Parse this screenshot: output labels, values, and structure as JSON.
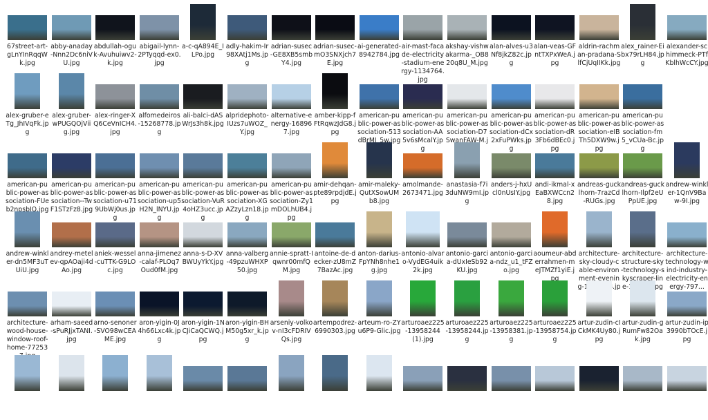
{
  "files": [
    [
      "67street-art-gLnYInRqqWk.jpg",
      "abby-anaday-Nnn2Dc6niVU.jpg",
      "abdullah-oguk-Avuhuiwv2-k.jpg",
      "abigail-lynn-2PTyqqd-ex0.jpg",
      "a-c-qA894E_ILPo.jpg",
      "adly-hakim-Ir98XAtj1Ms.jpg",
      "adrian-susec-GE8XB5smbY4.jpg",
      "adrian-susec-mO3SNXjch7E.jpg",
      "ai-generated-8942784.jpg",
      "air-mast-facade-electricity-stadium-energy-1134764.jpg",
      "akshay-vishwakarma-_OB820q8U_M.jpg",
      "alan-alves-u3Nf8jkZ82c.jpg",
      "alan-veas-GFntTXPxWeA.jpg",
      "aldrin-rachman-pradana-SlfCjUqIIKk.jpg",
      "alex_rainer-Eibx79rLH84.jpg",
      "alexander-schimmeck-PTfKblhWcCY.jpg"
    ],
    [
      "alex-gruber-eTg_JhIVqFk.jpg",
      "alex-gruber-wPUGQOjViig.jpg",
      "alex-ringer-XQ6CeVnICH4.jpg",
      "alfomedeiros-15268778.jpg",
      "ali-balci-dASWrJs3h8k.jpg",
      "alpridephoto-IUzs7uWOZ_Y.jpg",
      "alternative-energy-168967.jpg",
      "amber-kipp-fFtRqwzJdG8.jpg",
      "american-public-power-association-513dBrMJ_5w.jpg",
      "american-public-power-association-AA5v6sMcalY.jpg",
      "american-public-power-association-D7SwanFAW-M.jpg",
      "american-public-power-association-dCx2xFuPWks.jpg",
      "american-public-power-association-dR3Fb6dBEc0.jpg",
      "american-public-power-association-eIBTh5DXW9w.jpg",
      "american-public-power-association-fm5_vCUa-Bc.jpg"
    ],
    [
      "american-public-power-association-FUeb2npsbIQ.jpg",
      "american-public-power-association--TwF1STzFz8.jpg",
      "american-public-power-association-u719UbWj0us.jpg",
      "american-public-power-association-up5H2N_lNYU.jpg",
      "american-public-power-association-VuR4oHZ3ucc.jpg",
      "american-public-power-association-XGAZzyLzn18.jpg",
      "american-public-power-association-Zy1mDOLhUB4.jpg",
      "amir-dehqan-pte89rpdjdE.jpg",
      "amir-maleky-QutXSowUMb8.jpg",
      "amolmande-2673471.jpg",
      "anastasia-f7i3duNW9mI.jpg",
      "anders-j-hxUcl0nUsIY.jpg",
      "andi-ikmal-xEaBXWCcn28.jpg",
      "andreas-gucklhorn-7razCd-RUGs.jpg",
      "andreas-gucklhorn-Ilpf2eUPpUE.jpg",
      "andrew-winkler-1QnV9Baw-9I.jpg"
    ],
    [
      "andrew-winkler-dn5MF3uTUiU.jpg",
      "andrey-metelev-qpAOaji4dAo.jpg",
      "aniek-wessel-cuTTK-G9LOc.jpg",
      "anna-jimenez-calaf-PLOq7Oud0fM.jpg",
      "anna-s-D-XVBWUyYkY.jpg",
      "anna-valberg-49pzuWHXP50.jpg",
      "annie-spratt-Iqwnr00mfQM.jpg",
      "antoine-de-decker-zU8mZ7BazAc.jpg",
      "anton-darius-FpYNh8nhe1g.jpg",
      "antonio-alvaro-VydEG4uik2k.jpg",
      "antonio-garcia-dUxIeSb92KU.jpg",
      "antonio-garcia-ndz_u1_tFZo.jpg",
      "aoumeur-abderrahmen-meJTMZf1yiE.jpg",
      "architecture-sky-cloudy-cable-environment-evening-1112688.jpg",
      "architecture-structure-sky-technology-skyscraper-line-1397....jpg",
      "architecture-technology-wind-industry-electricity-energy-797..."
    ],
    [
      "architecture-wood-house-window-roof-home-772537.jpg",
      "arham-saeed-sPuRJjxTANI.jpg",
      "arno-senoner-SVO98wCEAME.jpg",
      "aron-yigin-0J4h66Lxc4k.jpg",
      "aron-yigin-1NCJiCaQCWQ.jpg",
      "aron-yigin-BHM50g5xr_k.jpg",
      "arseniy-volkov-nI3cFDRIVQs.jpg",
      "artempodrez-6990303.jpg",
      "arteum-ro-ZYu6P9-Glic.jpg",
      "arturoaez225-13958244 (1).jpg",
      "arturoaez225-13958244.jpg",
      "arturoaez225-13958381.jpg",
      "arturoaez225-13958754.jpg",
      "artur-zudin-cICkMK4Uy80.jpg",
      "artur-zudin-gRumFw82Oak.jpg",
      "artur-zudin-ip3990bTOcE.jpg"
    ],
    [
      "",
      "",
      "",
      "",
      "",
      "",
      "",
      "",
      "",
      "",
      "",
      "",
      "",
      "",
      "",
      ""
    ]
  ],
  "shapes": [
    [
      "L",
      "L",
      "L",
      "L",
      "P",
      "L",
      "L",
      "L",
      "L",
      "L",
      "L",
      "L",
      "L",
      "L",
      "P",
      "L"
    ],
    [
      "P",
      "P",
      "L",
      "L",
      "L",
      "L",
      "L",
      "P",
      "L",
      "L",
      "L",
      "L",
      "L",
      "L",
      "L"
    ],
    [
      "L",
      "L",
      "L",
      "L",
      "L",
      "L",
      "L",
      "P",
      "P",
      "L",
      "P",
      "L",
      "L",
      "L",
      "L",
      "P"
    ],
    [
      "P",
      "L",
      "L",
      "L",
      "L",
      "L",
      "L",
      "L",
      "P",
      "S",
      "L",
      "L",
      "P",
      "P",
      "P",
      "L"
    ],
    [
      "L",
      "L",
      "L",
      "L",
      "L",
      "L",
      "P",
      "P",
      "P",
      "P",
      "P",
      "P",
      "P",
      "P",
      "P",
      "L"
    ],
    [
      "P",
      "P",
      "P",
      "P",
      "L",
      "L",
      "P",
      "P",
      "P",
      "L",
      "L",
      "L",
      "L",
      "L",
      "L",
      "L"
    ]
  ],
  "colors": [
    [
      "#3a6f8c",
      "#6f9ab5",
      "#10141c",
      "#7e92a8",
      "#1d2a38",
      "#3e5a7a",
      "#0e1018",
      "#0a0c14",
      "#3a7dc8",
      "#9aa4a8",
      "#a9b2b6",
      "#0c1220",
      "#0f1422",
      "#c9b49c",
      "#2a2f36",
      "#86aac0"
    ],
    [
      "#6f9cbf",
      "#5b87a9",
      "#8d9299",
      "#6f8ea6",
      "#1a1c20",
      "#9fb1c2",
      "#b6d0e6",
      "#0b0c10",
      "#3f72aa",
      "#2a2c50",
      "#e4e7ea",
      "#4f8ccc",
      "#e8e8ea",
      "#d2b48e",
      "#3a6e9e"
    ],
    [
      "#3f6b8a",
      "#2c3c66",
      "#4b6f95",
      "#6f8fb0",
      "#5a7a9a",
      "#4c7f99",
      "#8fa5b8",
      "#e08a3a",
      "#26344c",
      "#d56c2a",
      "#8aa0b0",
      "#7a8a6a",
      "#4a7a9a",
      "#8c9a48",
      "#6a9a4a",
      "#2b3a5e"
    ],
    [
      "#6a8fb0",
      "#b26f4a",
      "#5a6a88",
      "#b59484",
      "#d2d8de",
      "#8aa8c0",
      "#8aa86a",
      "#4a7a9a",
      "#c8b48a",
      "#cfe3f4",
      "#7a8a9a",
      "#b2aa9c",
      "#e06a2a",
      "#9ab4cc",
      "#5a6e8a",
      "#8ab0cc"
    ],
    [
      "#6d8fb0",
      "#e8eef4",
      "#6b8fb5",
      "#0a1428",
      "#0c1a30",
      "#0e1a2a",
      "#a88a8a",
      "#a6865a",
      "#8aa6c8",
      "#28a83a",
      "#2aa040",
      "#3aa83e",
      "#2aa03a",
      "#eef2f6",
      "#dce6ee",
      "#8aa8c8"
    ],
    [
      "#9ab8d4",
      "#dce4ec",
      "#8cb0d0",
      "#a8c0d8",
      "#6a8aa8",
      "#5a7896",
      "#8aa4c0",
      "#4a6a88",
      "#dce6f0",
      "#8aa0b8",
      "#2a3040",
      "#7890aa",
      "#b8c8d8",
      "#1a2230",
      "#a8b8c8",
      "#c8d4e0"
    ]
  ]
}
